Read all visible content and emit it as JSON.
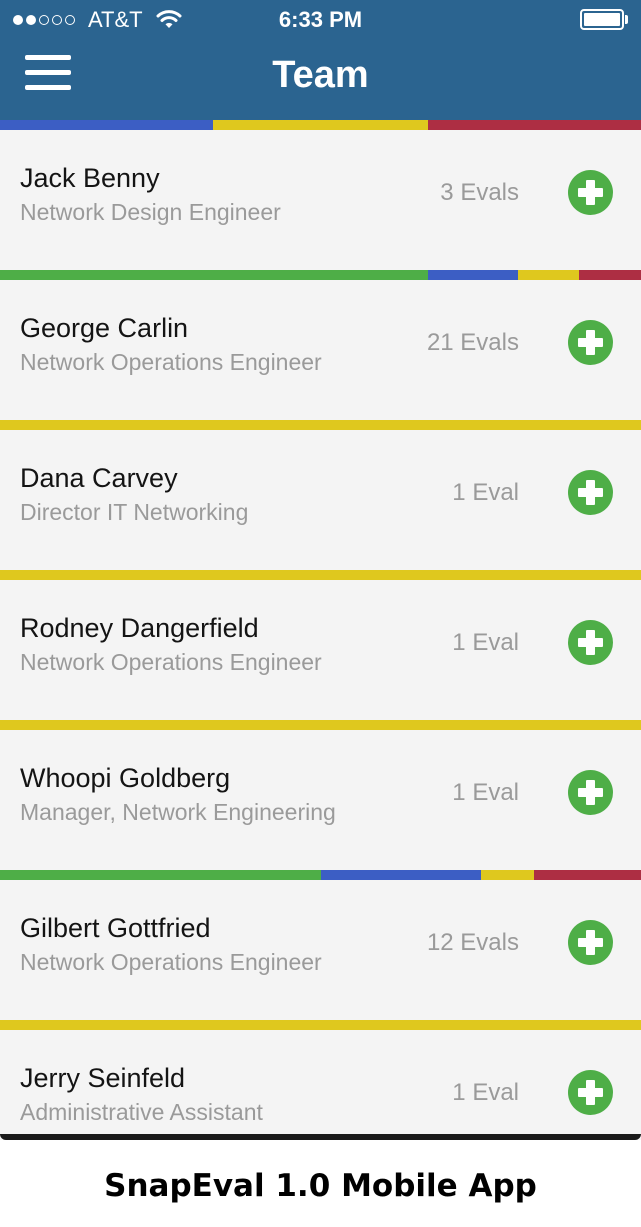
{
  "status_bar": {
    "signal_bars_filled": 2,
    "signal_bars_total": 5,
    "carrier": "AT&T",
    "wifi_icon": "wifi-icon",
    "time": "6:33 PM",
    "battery_level": 1.0
  },
  "header": {
    "menu_icon": "hamburger-menu-icon",
    "title": "Team",
    "color": "#2b6490"
  },
  "colors": {
    "blue": "#3c5ec4",
    "yellow": "#dfc81e",
    "red": "#ad2e43",
    "green": "#4eae47",
    "add_button": "#4eae47"
  },
  "members": [
    {
      "name": "Jack Benny",
      "role": "Network Design Engineer",
      "evals": "3 Evals"
    },
    {
      "name": "George Carlin",
      "role": "Network Operations Engineer",
      "evals": "21 Evals"
    },
    {
      "name": "Dana Carvey",
      "role": "Director IT Networking",
      "evals": "1 Eval"
    },
    {
      "name": "Rodney Dangerfield",
      "role": "Network Operations Engineer",
      "evals": "1 Eval"
    },
    {
      "name": "Whoopi Goldberg",
      "role": "Manager, Network Engineering",
      "evals": "1 Eval"
    },
    {
      "name": "Gilbert Gottfried",
      "role": "Network Operations Engineer",
      "evals": "12 Evals"
    },
    {
      "name": "Jerry Seinfeld",
      "role": "Administrative Assistant",
      "evals": "1 Eval"
    }
  ],
  "stripes": [
    [
      {
        "color": "blue",
        "share": 0.333
      },
      {
        "color": "yellow",
        "share": 0.334
      },
      {
        "color": "red",
        "share": 0.333
      }
    ],
    [
      {
        "color": "green",
        "share": 0.667
      },
      {
        "color": "blue",
        "share": 0.141
      },
      {
        "color": "yellow",
        "share": 0.095
      },
      {
        "color": "red",
        "share": 0.097
      }
    ],
    [
      {
        "color": "yellow",
        "share": 1.0
      }
    ],
    [
      {
        "color": "yellow",
        "share": 1.0
      }
    ],
    [
      {
        "color": "yellow",
        "share": 1.0
      }
    ],
    [
      {
        "color": "green",
        "share": 0.5
      },
      {
        "color": "blue",
        "share": 0.25
      },
      {
        "color": "yellow",
        "share": 0.083
      },
      {
        "color": "red",
        "share": 0.167
      }
    ],
    [
      {
        "color": "yellow",
        "share": 1.0
      }
    ]
  ],
  "caption": "SnapEval 1.0 Mobile App"
}
